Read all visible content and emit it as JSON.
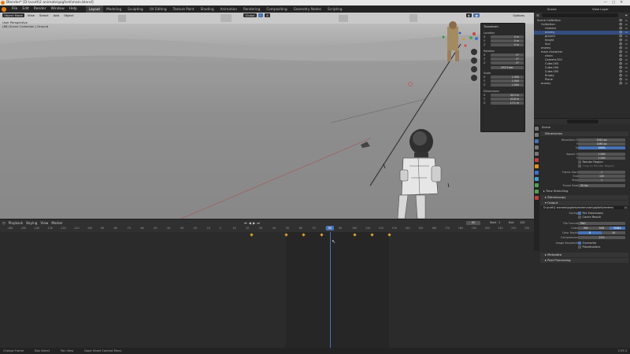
{
  "window": {
    "title": "Blender* [D:\\scott\\2 animate\\pigfork\\main.blend]",
    "icon": "blender-logo-icon"
  },
  "topbar": {
    "menus": [
      "File",
      "Edit",
      "Render",
      "Window",
      "Help"
    ],
    "workspaces": [
      "Layout",
      "Modeling",
      "Sculpting",
      "UV Editing",
      "Texture Paint",
      "Shading",
      "Animation",
      "Rendering",
      "Compositing",
      "Geometry Nodes",
      "Scripting"
    ],
    "active_workspace": "Layout",
    "scene_label": "Scene",
    "viewlayer_label": "View Layer"
  },
  "viewport": {
    "mode": "Object Mode",
    "menus": [
      "View",
      "Select",
      "Add",
      "Object"
    ],
    "transform_orientation": "Global",
    "options_label": "Options",
    "info_line1": "User Perspective",
    "info_line2": "(88) Scene Collection | Ground",
    "panel_title": "Transform",
    "location_label": "Location",
    "location": [
      "0 m",
      "0 m",
      "0 m"
    ],
    "rotation_label": "Rotation",
    "rotation": [
      "0°",
      "0°",
      "0°"
    ],
    "mode_label": "XYZ Euler",
    "scale_label": "Scale",
    "scale": [
      "1.000",
      "1.000",
      "1.000"
    ],
    "dimensions_label": "Dimensions",
    "dimensions": [
      "44.3 m",
      "43.8 m",
      "17.1 m"
    ],
    "axis_labels": [
      "X",
      "Y",
      "Z"
    ],
    "ground_color": "#8e8e8e"
  },
  "timeline": {
    "menus": [
      "Playback",
      "Keying",
      "View",
      "Marker"
    ],
    "current_frame": "88",
    "start_label": "Start",
    "start": "1",
    "end_label": "End",
    "end": "120",
    "ticks": [
      "-160",
      "-150",
      "-140",
      "-130",
      "-120",
      "-110",
      "-100",
      "-90",
      "-80",
      "-70",
      "-60",
      "-50",
      "-40",
      "-30",
      "-20",
      "-10",
      "0",
      "10",
      "20",
      "30",
      "40",
      "50",
      "60",
      "70",
      "80",
      "90",
      "100",
      "110",
      "120",
      "130",
      "140",
      "150",
      "160",
      "170",
      "180",
      "190",
      "200",
      "210",
      "220",
      "230",
      "240"
    ],
    "accent": "#4772b3"
  },
  "outliner": {
    "search_placeholder": "",
    "rows": [
      {
        "label": "Scene Collection",
        "indent": 0,
        "selected": false
      },
      {
        "label": "Collection",
        "indent": 1,
        "selected": false
      },
      {
        "label": "Camera",
        "indent": 2,
        "selected": false
      },
      {
        "label": "enemy",
        "indent": 2,
        "selected": true
      },
      {
        "label": "ground",
        "indent": 2,
        "selected": false
      },
      {
        "label": "knight",
        "indent": 2,
        "selected": false
      },
      {
        "label": "Sun",
        "indent": 2,
        "selected": false
      },
      {
        "label": "enemy",
        "indent": 1,
        "selected": false
      },
      {
        "label": "main character",
        "indent": 1,
        "selected": false
      },
      {
        "label": "chain",
        "indent": 2,
        "selected": false
      },
      {
        "label": "Camera.001",
        "indent": 2,
        "selected": false
      },
      {
        "label": "Cube.003",
        "indent": 2,
        "selected": false
      },
      {
        "label": "Cube.004",
        "indent": 2,
        "selected": false
      },
      {
        "label": "Cube.005",
        "indent": 2,
        "selected": false
      },
      {
        "label": "Empty",
        "indent": 2,
        "selected": false
      },
      {
        "label": "Plane",
        "indent": 2,
        "selected": false
      },
      {
        "label": "enemy",
        "indent": 1,
        "selected": false
      }
    ]
  },
  "properties": {
    "scene_name": "Scene",
    "dimensions_section": "Dimensions",
    "resolution_x_label": "Resolution X",
    "resolution_x": "1920 px",
    "resolution_y_label": "Y",
    "resolution_y": "1080 px",
    "percent_label": "%",
    "percent": "100%",
    "aspect_x_label": "Aspect X",
    "aspect_x": "1.000",
    "aspect_y_label": "Y",
    "aspect_y": "1.000",
    "render_region": "Render Region",
    "crop_region": "Crop to Render Region",
    "frame_start_label": "Frame Start",
    "frame_start": "1",
    "frame_end_label": "End",
    "frame_end": "120",
    "frame_step_label": "Step",
    "frame_step": "1",
    "frame_rate_label": "Frame Rate",
    "frame_rate": "30 fps",
    "time_stretching": "Time Stretching",
    "stereoscopy": "Stereoscopy",
    "output_section": "Output",
    "output_path": "D:\\scott\\2 animate\\pigfork\\render\\main\\pigfork\\renders\\",
    "saving_label": "Saving",
    "file_extensions": "File Extensions",
    "cache_result": "Cache Result",
    "file_format_label": "File Format",
    "file_format": "PNG",
    "color_label": "Color",
    "color_options": [
      "BW",
      "RGB",
      "RGBA"
    ],
    "color_selected": "RGBA",
    "color_depth_label": "Color Depth",
    "color_depth_options": [
      "8",
      "16"
    ],
    "color_depth_selected": "8",
    "compression_label": "Compression",
    "compression": "15%",
    "image_sequence_label": "Image Sequence",
    "overwrite": "Overwrite",
    "placeholders": "Placeholders",
    "metadata": "Metadata",
    "post_processing": "Post Processing"
  },
  "statusbar": {
    "items": [
      "Change Frame",
      "Box Select",
      "Pan View",
      "Dope Sheet Context Menu"
    ],
    "version": "2.93.3"
  }
}
